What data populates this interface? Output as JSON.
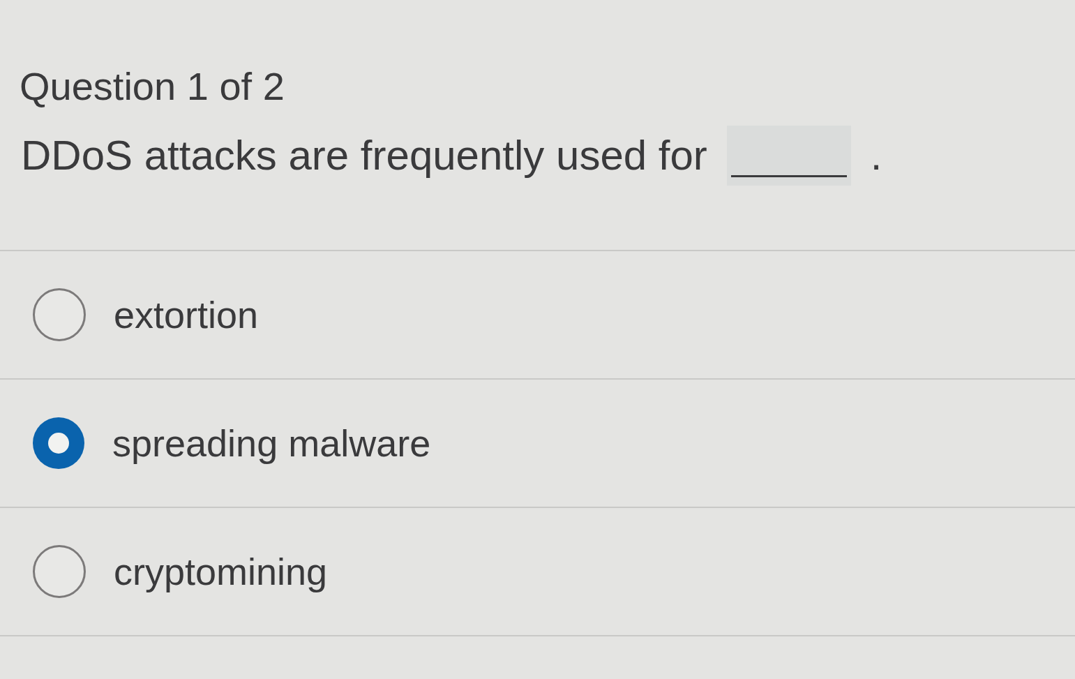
{
  "header": {
    "title": "Question 1 of 2"
  },
  "question": {
    "parts": [
      {
        "kind": "text",
        "text": "DDoS attacks are frequently used for"
      },
      {
        "kind": "blank"
      },
      {
        "kind": "text",
        "text": "."
      }
    ]
  },
  "options": [
    {
      "label": "extortion",
      "selected": false
    },
    {
      "label": "spreading malware",
      "selected": true
    },
    {
      "label": "cryptomining",
      "selected": false
    }
  ]
}
